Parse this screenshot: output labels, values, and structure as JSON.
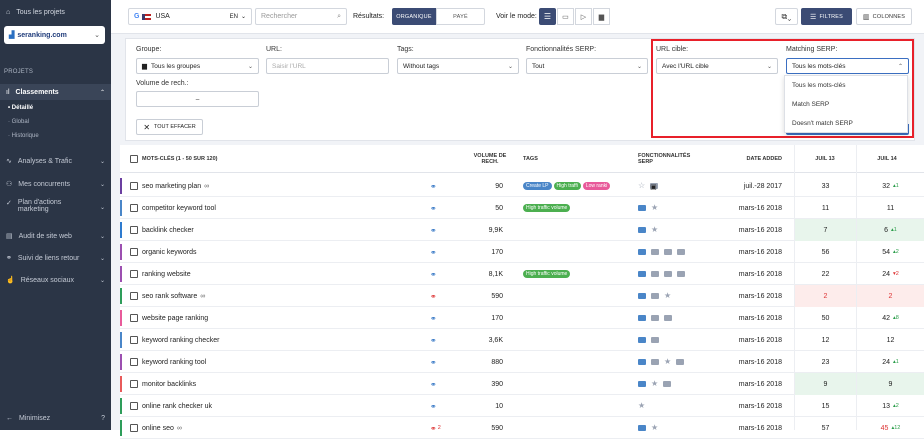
{
  "sidebar": {
    "all_projects": "Tous les projets",
    "project_name": "seranking.com",
    "section": "PROJETS",
    "rankings": "Classements",
    "sub_items": [
      "Détaillé",
      "Global",
      "Historique"
    ],
    "items": [
      "Analyses & Trafic",
      "Mes concurrents",
      "Plan d'actions",
      "marketing",
      "Audit de site web",
      "Suivi de liens retour",
      "Réseaux sociaux"
    ],
    "minimize": "Minimisez"
  },
  "topbar": {
    "engine_country": "USA",
    "lang": "EN",
    "search_placeholder": "Rechercher",
    "results_label": "Résultats:",
    "organic": "ORGANIQUE",
    "paid": "PAYÉ",
    "view_mode_label": "Voir le mode:",
    "filters_btn": "FILTRES",
    "columns_btn": "COLONNES"
  },
  "filters": {
    "group_label": "Groupe:",
    "group_value": "Tous les groupes",
    "url_label": "URL:",
    "url_placeholder": "Saisir l'URL",
    "tags_label": "Tags:",
    "tags_value": "Without tags",
    "serp_label": "Fonctionnalités SERP:",
    "serp_value": "Tout",
    "target_url_label": "URL cible:",
    "target_url_value": "Avec l'URL cible",
    "matching_label": "Matching SERP:",
    "matching_value": "Tous les mots-clés",
    "volume_label": "Volume de rech.:",
    "volume_value": "–",
    "clear_btn": "TOUT EFFACER",
    "dropdown_options": [
      "Tous les mots-clés",
      "Match SERP",
      "Doesn't match SERP"
    ]
  },
  "table": {
    "headers": {
      "keywords": "MOTS-CLÉS (1 - 50 SUR 120)",
      "volume_1": "VOLUME DE",
      "volume_2": "RECH.",
      "tags": "TAGS",
      "serp_1": "FONCTIONNALITÉS",
      "serp_2": "SERP",
      "date": "DATE ADDED",
      "jul13": "JUIL 13",
      "jul14": "JUIL 14"
    },
    "rows": [
      {
        "kw": "seo marketing plan",
        "extra": "∞",
        "vol": "90",
        "date": "juil.-28 2017",
        "p13": "33",
        "p14": "32",
        "d14": "1",
        "accent": "#6b3fa0",
        "link": "blue",
        "tags": [
          "Create LP",
          "High traffi",
          "Low ranki"
        ]
      },
      {
        "kw": "competitor keyword tool",
        "extra": "",
        "vol": "50",
        "date": "mars-16 2018",
        "p13": "11",
        "p14": "11",
        "d14": "",
        "accent": "#4a86c8",
        "link": "blue",
        "tags": [
          "High traffic volume"
        ]
      },
      {
        "kw": "backlink checker",
        "extra": "",
        "vol": "9,9K",
        "date": "mars-16 2018",
        "p13": "7",
        "p14": "6",
        "d14": "1",
        "accent": "#2e7bcf",
        "link": "blue",
        "tags": []
      },
      {
        "kw": "organic keywords",
        "extra": "",
        "vol": "170",
        "date": "mars-16 2018",
        "p13": "56",
        "p14": "54",
        "d14": "2",
        "accent": "#9c4fb0",
        "link": "blue",
        "tags": []
      },
      {
        "kw": "ranking website",
        "extra": "",
        "vol": "8,1K",
        "date": "mars-16 2018",
        "p13": "22",
        "p14": "24",
        "d14": "2",
        "accent": "#9c4fb0",
        "link": "blue",
        "tags": [
          "High traffic volume"
        ]
      },
      {
        "kw": "seo rank software",
        "extra": "∞",
        "vol": "590",
        "date": "mars-16 2018",
        "p13": "2",
        "p14": "2",
        "d14": "",
        "accent": "#2e9d5a",
        "link": "red",
        "tags": []
      },
      {
        "kw": "website page ranking",
        "extra": "",
        "vol": "170",
        "date": "mars-16 2018",
        "p13": "50",
        "p14": "42",
        "d14": "8",
        "accent": "#e85a9a",
        "link": "blue",
        "tags": []
      },
      {
        "kw": "keyword ranking checker",
        "extra": "",
        "vol": "3,6K",
        "date": "mars-16 2018",
        "p13": "12",
        "p14": "12",
        "d14": "",
        "accent": "#4a86c8",
        "link": "blue",
        "tags": []
      },
      {
        "kw": "keyword ranking tool",
        "extra": "",
        "vol": "880",
        "date": "mars-16 2018",
        "p13": "23",
        "p14": "24",
        "d14": "1",
        "accent": "#9c4fb0",
        "link": "blue",
        "tags": []
      },
      {
        "kw": "monitor backlinks",
        "extra": "",
        "vol": "390",
        "date": "mars-16 2018",
        "p13": "9",
        "p14": "9",
        "d14": "",
        "accent": "#e85a5a",
        "link": "blue",
        "tags": []
      },
      {
        "kw": "online rank checker uk",
        "extra": "",
        "vol": "10",
        "date": "mars-16 2018",
        "p13": "15",
        "p14": "13",
        "d14": "2",
        "accent": "#2e9d5a",
        "link": "blue",
        "tags": []
      },
      {
        "kw": "online seo",
        "extra": "∞",
        "vol": "590",
        "date": "mars-16 2018",
        "p13": "57",
        "p14": "45",
        "d14": "12",
        "accent": "#2e9d5a",
        "link": "red2",
        "tags": []
      }
    ]
  }
}
